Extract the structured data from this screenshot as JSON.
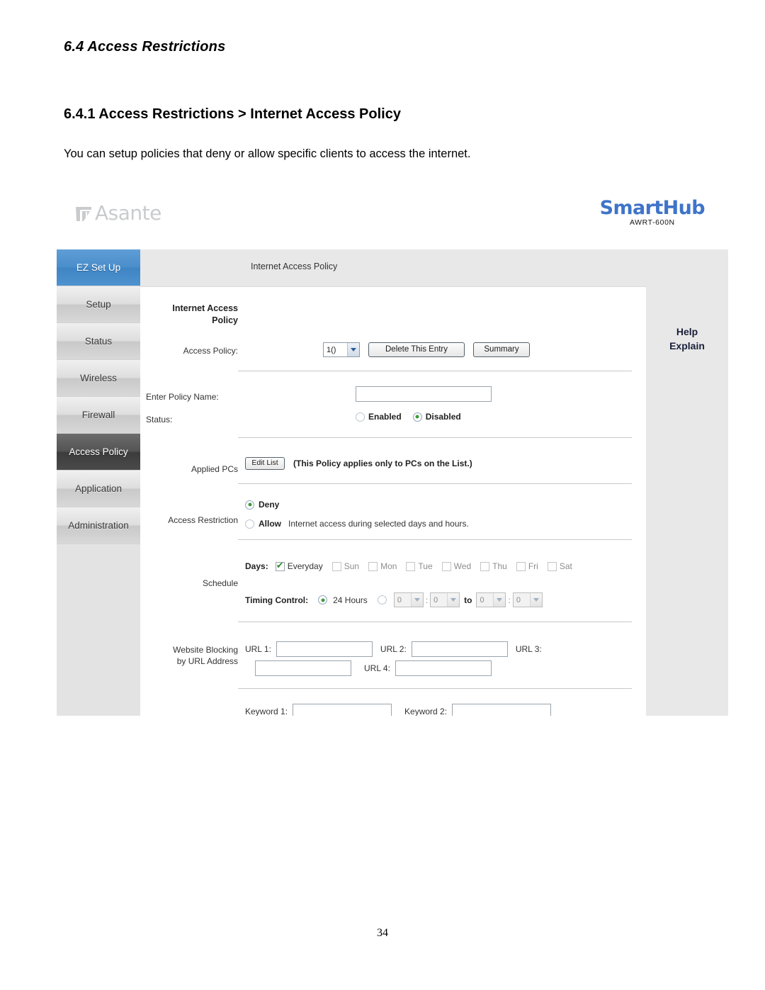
{
  "document": {
    "section_number_title": "6.4  Access Restrictions",
    "subsection_title": "6.4.1 Access Restrictions > Internet Access Policy",
    "body_text": "You can setup policies that deny or allow specific clients to access the internet.",
    "page_number": "34"
  },
  "brand": {
    "vendor": "Asante",
    "product": "SmartHub",
    "model": "AWRT-600N",
    "product_color": "#3f74c8",
    "vendor_color": "#c9cbcd"
  },
  "sidebar": {
    "items": [
      {
        "label": "EZ Set Up",
        "state": "highlighted"
      },
      {
        "label": "Setup",
        "state": "normal"
      },
      {
        "label": "Status",
        "state": "normal"
      },
      {
        "label": "Wireless",
        "state": "normal"
      },
      {
        "label": "Firewall",
        "state": "normal"
      },
      {
        "label": "Access Policy",
        "state": "selected"
      },
      {
        "label": "Application",
        "state": "normal"
      },
      {
        "label": "Administration",
        "state": "normal"
      }
    ],
    "highlight_color": "#4a8ecb",
    "selected_color": "#545454"
  },
  "topbar": {
    "page_name": "Internet Access Policy"
  },
  "help": {
    "line1": "Help",
    "line2": "Explain"
  },
  "panel": {
    "section_title_line1": "Internet Access",
    "section_title_line2": "Policy",
    "access_policy": {
      "label": "Access Policy:",
      "selected_option": "1()",
      "delete_button": "Delete This Entry",
      "summary_button": "Summary"
    },
    "policy_name": {
      "label": "Enter Policy Name:",
      "value": "",
      "placeholder": ""
    },
    "status": {
      "label": "Status:",
      "options": [
        "Enabled",
        "Disabled"
      ],
      "selected": "Disabled"
    },
    "applied_pcs": {
      "label": "Applied PCs",
      "button": "Edit List",
      "note": "(This Policy applies only to PCs on the List.)"
    },
    "access_restriction": {
      "label": "Access Restriction",
      "options": [
        {
          "label": "Deny",
          "note": "",
          "selected": true
        },
        {
          "label": "Allow",
          "note": "Internet access during selected days and hours.",
          "selected": false
        }
      ]
    },
    "schedule": {
      "label": "Schedule",
      "days_label": "Days:",
      "days": [
        {
          "label": "Everyday",
          "checked": true,
          "enabled": true
        },
        {
          "label": "Sun",
          "checked": false,
          "enabled": false
        },
        {
          "label": "Mon",
          "checked": false,
          "enabled": false
        },
        {
          "label": "Tue",
          "checked": false,
          "enabled": false
        },
        {
          "label": "Wed",
          "checked": false,
          "enabled": false
        },
        {
          "label": "Thu",
          "checked": false,
          "enabled": false
        },
        {
          "label": "Fri",
          "checked": false,
          "enabled": false
        },
        {
          "label": "Sat",
          "checked": false,
          "enabled": false
        }
      ],
      "timing_label": "Timing Control:",
      "twentyfour_hours_label": "24 Hours",
      "twentyfour_hours_selected": true,
      "custom_selected": false,
      "to_label": "to",
      "colon": ":",
      "start_hour": "0",
      "start_minute": "0",
      "end_hour": "0",
      "end_minute": "0"
    },
    "website_blocking": {
      "label_line1": "Website Blocking",
      "label_line2": "by URL Address",
      "fields": [
        {
          "label": "URL 1:",
          "value": ""
        },
        {
          "label": "URL 2:",
          "value": ""
        },
        {
          "label": "URL 3:",
          "value": ""
        },
        {
          "label": "URL 4:",
          "value": ""
        }
      ]
    },
    "keyword_blocking": {
      "fields": [
        {
          "label": "Keyword 1:",
          "value": ""
        },
        {
          "label": "Keyword 2:",
          "value": ""
        }
      ]
    }
  }
}
